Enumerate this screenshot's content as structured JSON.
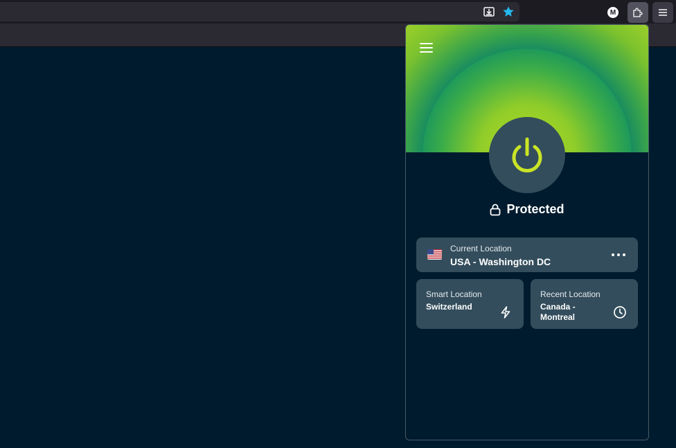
{
  "browser": {
    "profile_initial": "M",
    "icons": {
      "download": "download-icon",
      "bookmark": "star-icon",
      "extensions": "puzzle-icon",
      "menu": "hamburger-icon"
    },
    "bookmark_color": "#24b8ef"
  },
  "vpn": {
    "status": "Protected",
    "accent_color": "#c9e426",
    "current_location": {
      "label": "Current Location",
      "value": "USA - Washington DC",
      "flag": "us-flag"
    },
    "smart_location": {
      "label": "Smart Location",
      "value": "Switzerland",
      "icon": "lightning-icon"
    },
    "recent_location": {
      "label": "Recent Location",
      "value_line1": "Canada -",
      "value_line2": "Montreal",
      "icon": "clock-icon"
    }
  }
}
